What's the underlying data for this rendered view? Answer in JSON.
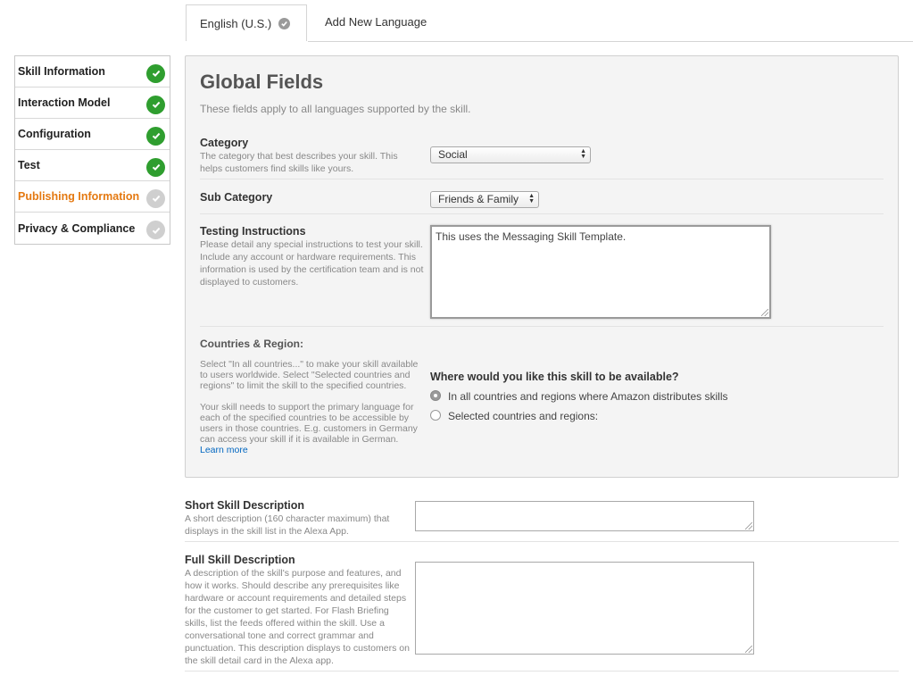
{
  "tabs": {
    "active_label": "English (U.S.)",
    "add_label": "Add New Language"
  },
  "sidebar": {
    "items": [
      {
        "label": "Skill Information",
        "status": "done"
      },
      {
        "label": "Interaction Model",
        "status": "done"
      },
      {
        "label": "Configuration",
        "status": "done"
      },
      {
        "label": "Test",
        "status": "done"
      },
      {
        "label": "Publishing Information",
        "status": "pending"
      },
      {
        "label": "Privacy & Compliance",
        "status": "pending"
      }
    ],
    "active_index": 4
  },
  "global": {
    "title": "Global Fields",
    "subtitle": "These fields apply to all languages supported by the skill.",
    "category": {
      "label": "Category",
      "help": "The category that best describes your skill. This helps customers find skills like yours.",
      "value": "Social"
    },
    "sub_category": {
      "label": "Sub Category",
      "value": "Friends & Family"
    },
    "testing": {
      "label": "Testing Instructions",
      "help": "Please detail any special instructions to test your skill. Include any account or hardware requirements. This information is used by the certification team and is not displayed to customers.",
      "value": "This uses the Messaging Skill Template."
    },
    "countries": {
      "label": "Countries & Region:",
      "help1": "Select \"In all countries...\" to make your skill available to users worldwide. Select \"Selected countries and regions\" to limit the skill to the specified countries.",
      "help2": "Your skill needs to support the primary language for each of the specified countries to be accessible by users in those countries. E.g. customers in Germany can access your skill if it is available in German.",
      "learn_more": "Learn more",
      "question": "Where would you like this skill to be available?",
      "option_all": "In all countries and regions where Amazon distributes skills",
      "option_selected": "Selected countries and regions:",
      "selected_option": "all"
    }
  },
  "short_desc": {
    "label": "Short Skill Description",
    "help": "A short description (160 character maximum) that displays in the skill list in the Alexa App.",
    "value": ""
  },
  "full_desc": {
    "label": "Full Skill Description",
    "help": "A description of the skill's purpose and features, and how it works. Should describe any prerequisites like hardware or account requirements and detailed steps for the customer to get started. For Flash Briefing skills, list the feeds offered within the skill. Use a conversational tone and correct grammar and punctuation. This description displays to customers on the skill detail card in the Alexa app.",
    "value": ""
  },
  "colors": {
    "accent_orange": "#e47911",
    "done_green": "#2f9e2f",
    "pending_gray": "#cfcfcf",
    "link_blue": "#0066c0"
  }
}
